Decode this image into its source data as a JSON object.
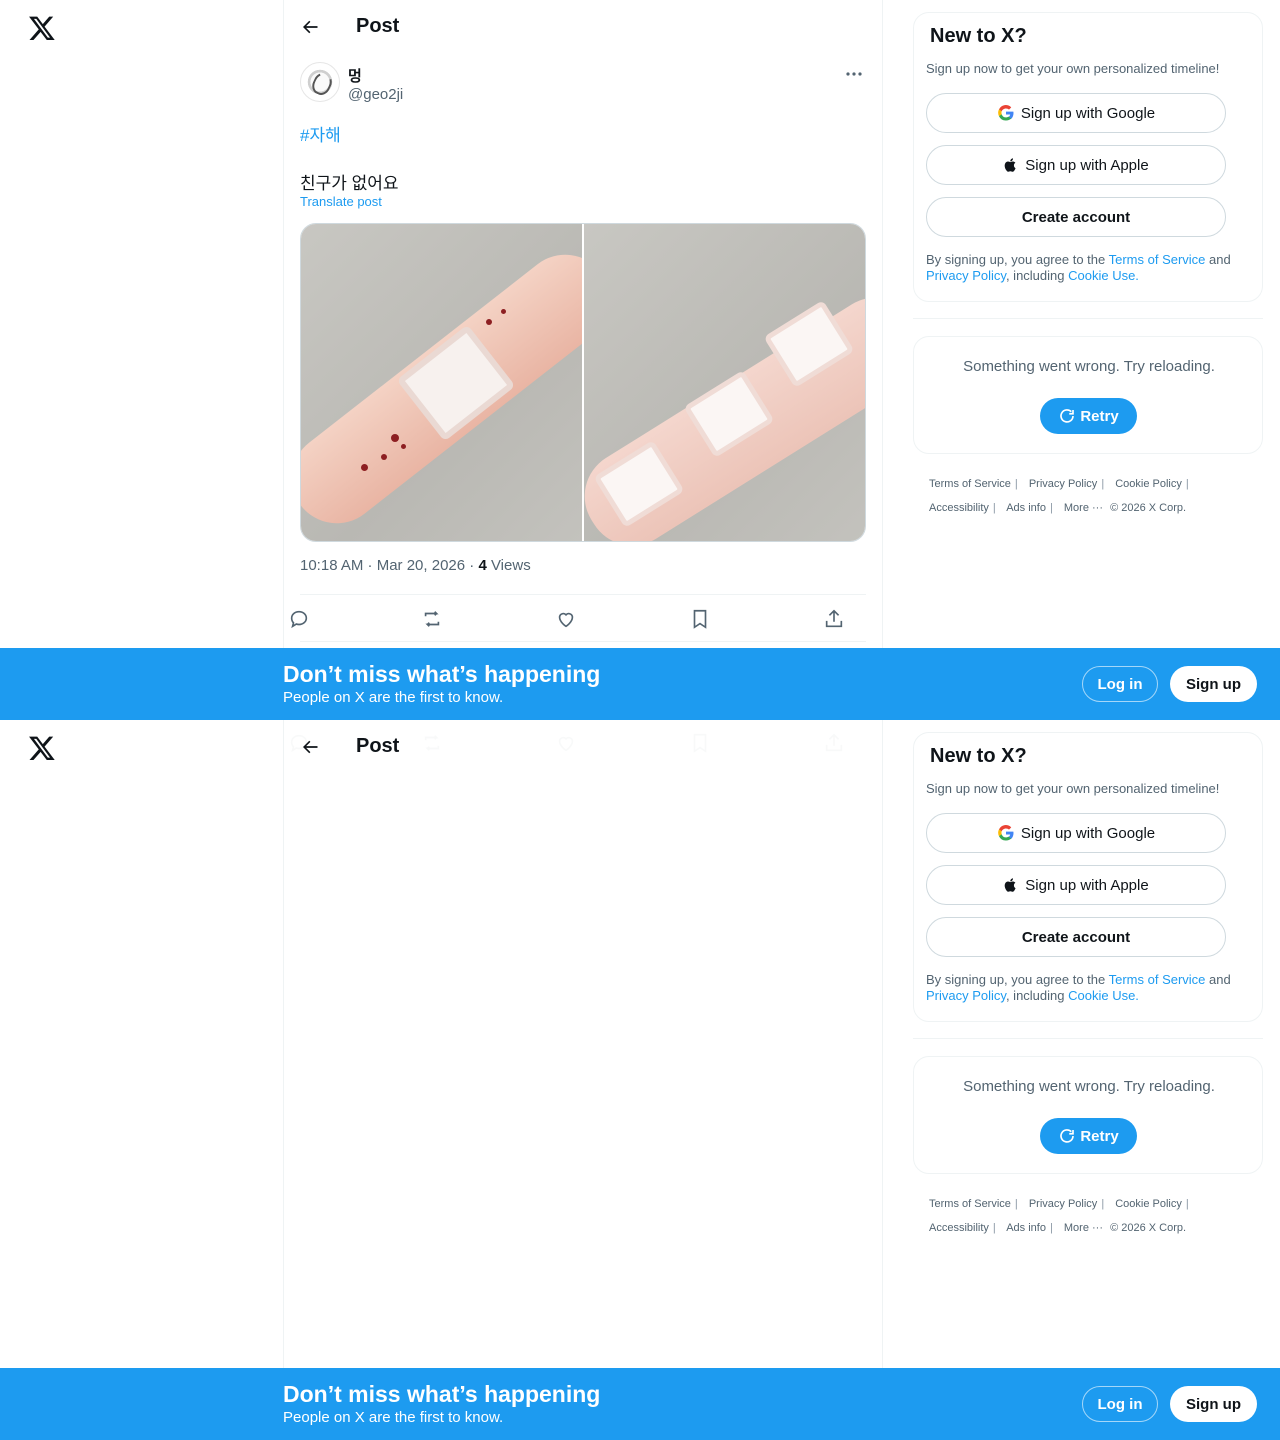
{
  "header": {
    "title": "Post"
  },
  "post": {
    "author_name": "멍",
    "author_handle": "@geo2ji",
    "hashtag": "#자해",
    "text": "친구가 없어요",
    "translate_label": "Translate post",
    "time": "10:18 AM · Mar 20, 2026 · ",
    "views_count": "4",
    "views_label": " Views"
  },
  "signup_card": {
    "title": "New to X?",
    "subtitle": "Sign up now to get your own personalized timeline!",
    "google_label": "Sign up with Google",
    "apple_label": "Sign up with Apple",
    "create_label": "Create account",
    "legal_prefix": "By signing up, you agree to the ",
    "tos": "Terms of Service",
    "and": " and ",
    "privacy": "Privacy Policy",
    "including": ", including ",
    "cookie": "Cookie Use."
  },
  "error_card": {
    "message": "Something went wrong. Try reloading.",
    "retry_label": "Retry"
  },
  "footer": {
    "links": [
      "Terms of Service",
      "Privacy Policy",
      "Cookie Policy",
      "Accessibility",
      "Ads info",
      "More ···"
    ],
    "copyright": "© 2026 X Corp."
  },
  "banner": {
    "title": "Don’t miss what’s happening",
    "subtitle": "People on X are the first to know.",
    "login_label": "Log in",
    "signup_label": "Sign up"
  },
  "colors": {
    "accent": "#1d9bf0",
    "text": "#0f1419",
    "muted": "#536471"
  }
}
